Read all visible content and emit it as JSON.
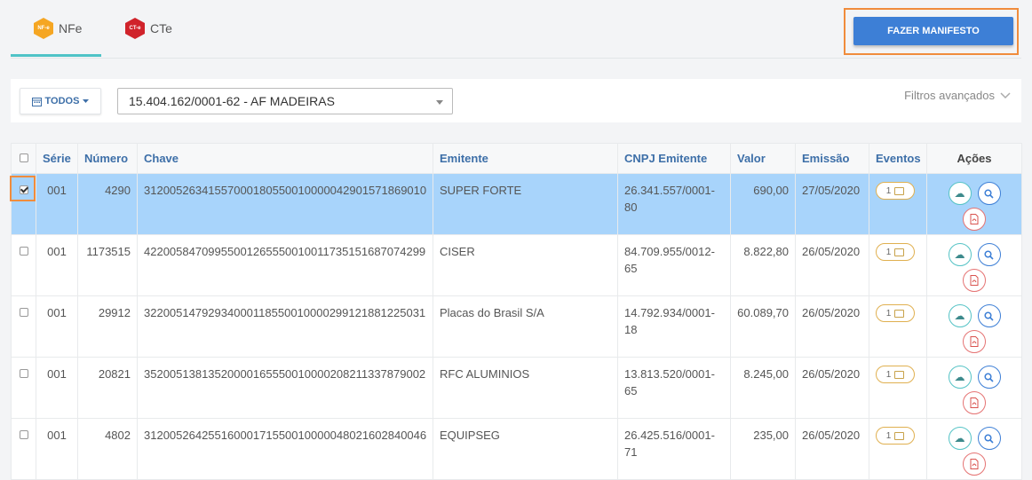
{
  "tabs": [
    {
      "label": "NFe",
      "icon_text": "NF-e",
      "active": true
    },
    {
      "label": "CTe",
      "icon_text": "CT-e",
      "active": false
    }
  ],
  "manifest_button": "FAZER MANIFESTO",
  "filters": {
    "todos_label": "TODOS",
    "company_select": "15.404.162/0001-62 - AF MADEIRAS",
    "advanced_label": "Filtros avançados"
  },
  "table": {
    "headers": [
      "Série",
      "Número",
      "Chave",
      "Emitente",
      "CNPJ Emitente",
      "Valor",
      "Emissão",
      "Eventos",
      "Ações"
    ],
    "rows": [
      {
        "checked": true,
        "serie": "001",
        "numero": "4290",
        "chave": "31200526341557000180550010000042901571869010",
        "emitente": "SUPER FORTE",
        "cnpj": "26.341.557/0001-80",
        "valor": "690,00",
        "emissao": "27/05/2020",
        "eventos": "1"
      },
      {
        "checked": false,
        "serie": "001",
        "numero": "1173515",
        "chave": "42200584709955001265550010011735151687074299",
        "emitente": "CISER",
        "cnpj": "84.709.955/0012-65",
        "valor": "8.822,80",
        "emissao": "26/05/2020",
        "eventos": "1"
      },
      {
        "checked": false,
        "serie": "001",
        "numero": "29912",
        "chave": "32200514792934000118550010000299121881225031",
        "emitente": "Placas do Brasil S/A",
        "cnpj": "14.792.934/0001-18",
        "valor": "60.089,70",
        "emissao": "26/05/2020",
        "eventos": "1"
      },
      {
        "checked": false,
        "serie": "001",
        "numero": "20821",
        "chave": "35200513813520000165550010000208211337879002",
        "emitente": "RFC ALUMINIOS",
        "cnpj": "13.813.520/0001-65",
        "valor": "8.245,00",
        "emissao": "26/05/2020",
        "eventos": "1"
      },
      {
        "checked": false,
        "serie": "001",
        "numero": "4802",
        "chave": "31200526425516000171550010000048021602840046",
        "emitente": "EQUIPSEG",
        "cnpj": "26.425.516/0001-71",
        "valor": "235,00",
        "emissao": "26/05/2020",
        "eventos": "1"
      }
    ]
  },
  "colors": {
    "accent": "#3d7fd6",
    "selected_row": "#a8d4fb",
    "highlight": "#f08c3c",
    "tab_underline": "#4fc3c7"
  }
}
